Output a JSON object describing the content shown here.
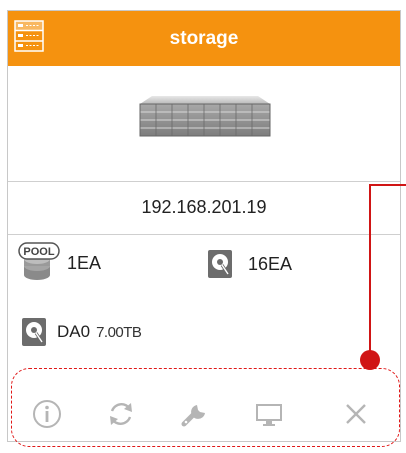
{
  "header": {
    "title": "storage",
    "background_color": "#f5920f",
    "icon": "server-list-icon"
  },
  "device": {
    "image": "storage-server-image"
  },
  "ip_address": "192.168.201.19",
  "info": {
    "pool_count": "1EA",
    "pool_icon_label": "POOL",
    "disk_count": "16EA",
    "da_label": "DA0",
    "da_size": "7.00TB"
  },
  "toolbar": {
    "buttons": [
      {
        "name": "info-icon"
      },
      {
        "name": "refresh-icon"
      },
      {
        "name": "wrench-icon"
      },
      {
        "name": "monitor-icon"
      },
      {
        "name": "close-icon"
      }
    ]
  },
  "annotation": {
    "color": "#d01515"
  }
}
